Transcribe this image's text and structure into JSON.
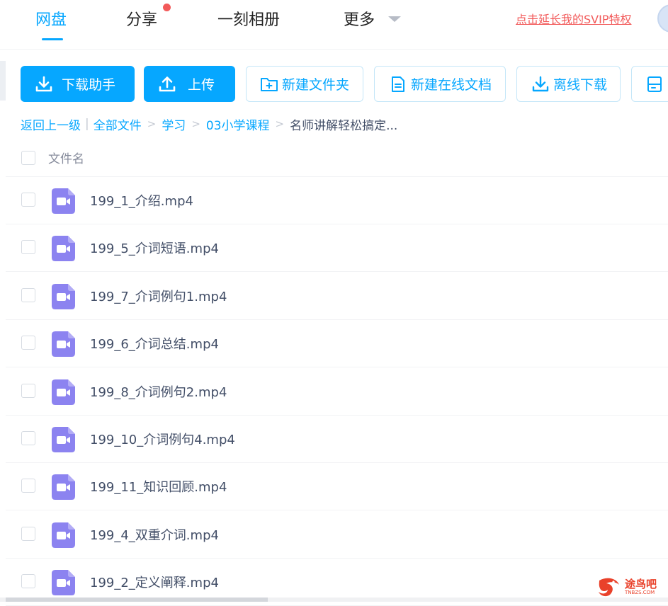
{
  "nav": {
    "tabs": [
      {
        "label": "网盘",
        "active": true
      },
      {
        "label": "分享",
        "badge": "red-dot"
      },
      {
        "label": "一刻相册"
      },
      {
        "label": "更多"
      }
    ],
    "svip_link": "点击延长我的SVIP特权"
  },
  "toolbar": {
    "download_helper": "下载助手",
    "upload": "上传",
    "new_folder": "新建文件夹",
    "new_online_doc": "新建在线文档",
    "offline_download": "离线下载"
  },
  "breadcrumb": {
    "back": "返回上一级",
    "all_files": "全部文件",
    "study": "学习",
    "course": "03小学课程",
    "current": "名师讲解轻松搞定..."
  },
  "list": {
    "header_name": "文件名",
    "files": [
      {
        "name": "199_1_介绍.mp4",
        "icon": "video-icon"
      },
      {
        "name": "199_5_介词短语.mp4",
        "icon": "video-icon"
      },
      {
        "name": "199_7_介词例句1.mp4",
        "icon": "video-icon"
      },
      {
        "name": "199_6_介词总结.mp4",
        "icon": "video-icon"
      },
      {
        "name": "199_8_介词例句2.mp4",
        "icon": "video-icon"
      },
      {
        "name": "199_10_介词例句4.mp4",
        "icon": "video-icon"
      },
      {
        "name": "199_11_知识回顾.mp4",
        "icon": "video-icon"
      },
      {
        "name": "199_4_双重介词.mp4",
        "icon": "video-icon"
      },
      {
        "name": "199_2_定义阐释.mp4",
        "icon": "video-icon"
      }
    ]
  },
  "watermark": {
    "text": "途鸟吧",
    "sub": "TNBZS.COM"
  },
  "colors": {
    "accent": "#06a7ff",
    "red": "#f25a5a",
    "video_icon": "#8c83f0",
    "text": "#424e67"
  }
}
